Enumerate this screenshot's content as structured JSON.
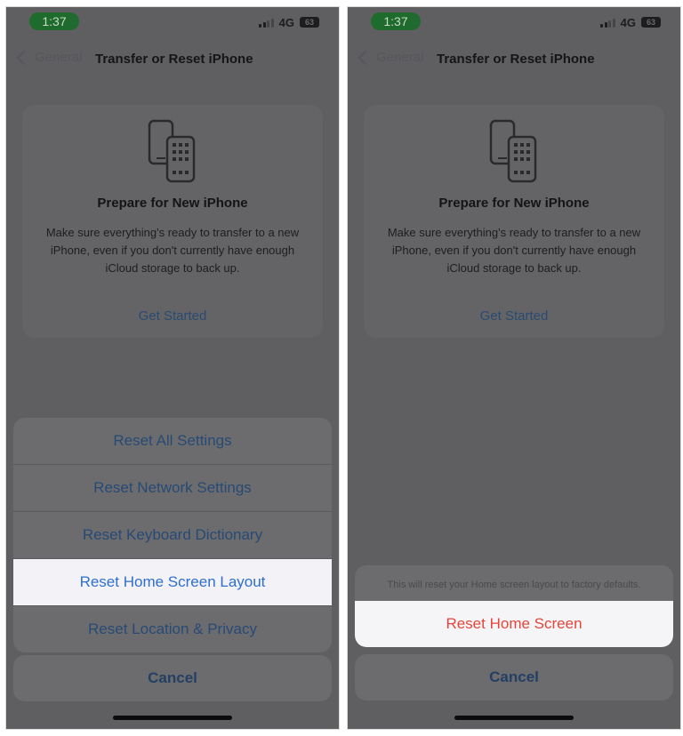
{
  "screens": [
    {
      "status": {
        "time": "1:37",
        "network": "4G",
        "battery": "63"
      },
      "nav": {
        "back_label": "General",
        "title": "Transfer or Reset iPhone"
      },
      "card": {
        "title": "Prepare for New iPhone",
        "body": "Make sure everything's ready to transfer to a new iPhone, even if you don't currently have enough iCloud storage to back up.",
        "link": "Get Started"
      },
      "sheet": {
        "items": [
          {
            "label": "Reset All Settings"
          },
          {
            "label": "Reset Network Settings"
          },
          {
            "label": "Reset Keyboard Dictionary"
          },
          {
            "label": "Reset Home Screen Layout",
            "highlighted": true
          },
          {
            "label": "Reset Location & Privacy"
          }
        ],
        "cancel_label": "Cancel"
      }
    },
    {
      "status": {
        "time": "1:37",
        "network": "4G",
        "battery": "63"
      },
      "nav": {
        "back_label": "General",
        "title": "Transfer or Reset iPhone"
      },
      "card": {
        "title": "Prepare for New iPhone",
        "body": "Make sure everything's ready to transfer to a new iPhone, even if you don't currently have enough iCloud storage to back up.",
        "link": "Get Started"
      },
      "sheet": {
        "note": "This will reset your Home screen layout to factory defaults.",
        "destructive_label": "Reset Home Screen",
        "cancel_label": "Cancel"
      }
    }
  ],
  "colors": {
    "accent_blue": "#2f6fcf",
    "destructive_red": "#e5453b",
    "time_pill_green": "#1f6b2e"
  }
}
